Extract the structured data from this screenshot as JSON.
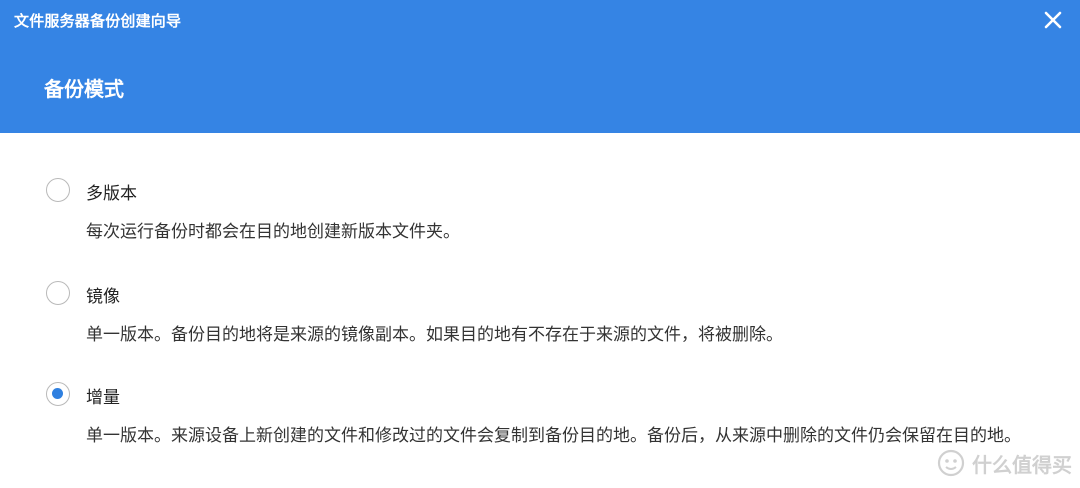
{
  "window": {
    "title": "文件服务器备份创建向导",
    "close_icon": "close-icon"
  },
  "header": {
    "section_title": "备份模式"
  },
  "options": [
    {
      "label": "多版本",
      "description": "每次运行备份时都会在目的地创建新版本文件夹。",
      "selected": false
    },
    {
      "label": "镜像",
      "description": "单一版本。备份目的地将是来源的镜像副本。如果目的地有不存在于来源的文件，将被删除。",
      "selected": false
    },
    {
      "label": "增量",
      "description": "单一版本。来源设备上新创建的文件和修改过的文件会复制到备份目的地。备份后，从来源中删除的文件仍会保留在目的地。",
      "selected": true
    }
  ],
  "watermark": {
    "text": "什么值得买"
  },
  "colors": {
    "header_bg": "#3584e4",
    "radio_selected": "#2f80e0",
    "radio_border": "#b9b9b9"
  }
}
